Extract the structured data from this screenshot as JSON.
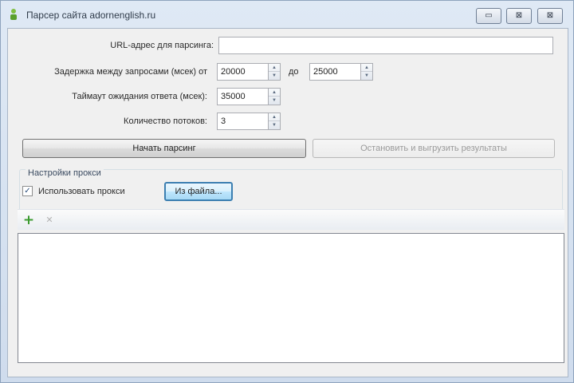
{
  "window": {
    "title": "Парсер сайта adornenglish.ru",
    "controls": {
      "minimize": "▭",
      "maximize": "⊠",
      "close": "⊠"
    }
  },
  "form": {
    "url_label": "URL-адрес для парсинга:",
    "url_value": "",
    "delay_label": "Задержка между запросами (мсек) от",
    "delay_from": "20000",
    "delay_to_label": "до",
    "delay_to": "25000",
    "timeout_label": "Таймаут ожидания ответа (мсек):",
    "timeout_value": "35000",
    "threads_label": "Количество потоков:",
    "threads_value": "3"
  },
  "actions": {
    "start_label": "Начать парсинг",
    "stop_label": "Остановить и выгрузить результаты"
  },
  "proxy": {
    "group_title": "Настройки прокси",
    "use_proxy_label": "Использовать прокси",
    "use_proxy_checked": true,
    "from_file_label": "Из файла..."
  },
  "toolbar": {
    "add_icon": "add-icon",
    "remove_icon": "remove-icon"
  },
  "proxy_list": {
    "items": []
  },
  "colors": {
    "accent": "#3c7fb1",
    "add_icon": "#3a9a2e"
  }
}
